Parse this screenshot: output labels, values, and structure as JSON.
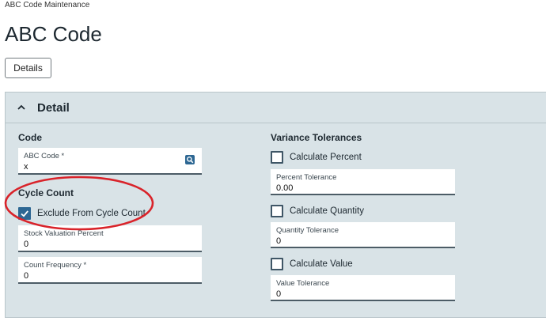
{
  "breadcrumb": "ABC Code Maintenance",
  "page_title": "ABC Code",
  "details_button": "Details",
  "panel": {
    "title": "Detail",
    "code_section": "Code",
    "abc_code": {
      "label": "ABC Code *",
      "value": "x"
    },
    "cycle_count_section": "Cycle Count",
    "exclude_cycle_count": {
      "label": "Exclude From Cycle Count",
      "checked": true
    },
    "stock_valuation": {
      "label": "Stock Valuation Percent",
      "value": "0"
    },
    "count_frequency": {
      "label": "Count Frequency *",
      "value": "0"
    },
    "variance_section": "Variance Tolerances",
    "calc_percent": {
      "label": "Calculate Percent",
      "checked": false
    },
    "percent_tolerance": {
      "label": "Percent Tolerance",
      "value": "0.00"
    },
    "calc_quantity": {
      "label": "Calculate Quantity",
      "checked": false
    },
    "quantity_tolerance": {
      "label": "Quantity Tolerance",
      "value": "0"
    },
    "calc_value": {
      "label": "Calculate Value",
      "checked": false
    },
    "value_tolerance": {
      "label": "Value Tolerance",
      "value": "0"
    }
  },
  "colors": {
    "accent": "#2d6793",
    "panel_bg": "#d9e3e7",
    "annotation": "#d9232a"
  }
}
